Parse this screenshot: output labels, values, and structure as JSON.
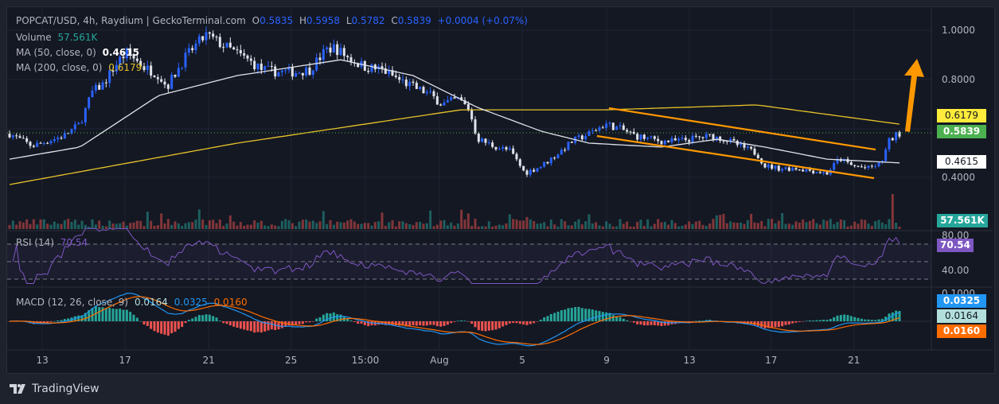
{
  "header": {
    "symbol": "POPCAT/USD, 4h, Raydium | GeckoTerminal.com",
    "o_label": "O",
    "o": "0.5835",
    "h_label": "H",
    "h": "0.5958",
    "l_label": "L",
    "l": "0.5782",
    "c_label": "C",
    "c": "0.5839",
    "change": "+0.0004 (+0.07%)"
  },
  "legend": {
    "volume_label": "Volume",
    "volume": "57.561K",
    "ma50_label": "MA (50, close, 0)",
    "ma50": "0.4615",
    "ma200_label": "MA (200, close, 0)",
    "ma200": "0.6179",
    "rsi_label": "RSI (14)",
    "rsi": "70.54",
    "macd_label": "MACD (12, 26, close, 9)",
    "macd_hist": "0.0164",
    "macd_line": "0.0325",
    "macd_signal": "0.0160"
  },
  "tags": {
    "ma200": "0.6179",
    "price": "0.5839",
    "ma50": "0.4615",
    "volume": "57.561K",
    "rsi": "70.54",
    "macd_line": "0.0325",
    "macd_hist": "0.0164",
    "macd_signal": "0.0160"
  },
  "colors": {
    "up": "#2962ff",
    "down": "#e0e3eb",
    "ma50": "#e0e3eb",
    "ma200": "#e6c229",
    "rsi": "#7e57c2",
    "macd": "#2196f3",
    "signal": "#ff6d00",
    "channel": "#ff9800",
    "price_tag": "#4caf50",
    "volume_tag": "#26a69a"
  },
  "branding": "TradingView",
  "chart_data": {
    "type": "candlestick",
    "title": "POPCAT/USD, 4h, Raydium",
    "price_axis": {
      "ticks": [
        "1.0000",
        "0.8000",
        "0.4000"
      ],
      "tick_values": [
        1.0,
        0.8,
        0.4
      ],
      "ylim": [
        0.235,
        1.09
      ]
    },
    "rsi_axis": {
      "ticks": [
        "80.00",
        "40.00"
      ],
      "tick_values": [
        80,
        40
      ],
      "bands": [
        70,
        50,
        30
      ]
    },
    "macd_axis": {
      "ticks": [
        "0.1000"
      ]
    },
    "time_axis": {
      "labels": [
        "13",
        "17",
        "21",
        "25",
        "15:00",
        "Aug",
        "5",
        "9",
        "13",
        "17",
        "21"
      ],
      "day_offsets": [
        1.58,
        5.58,
        9.62,
        13.6,
        17.19,
        20.77,
        24.77,
        28.85,
        32.85,
        36.8,
        40.8
      ]
    },
    "close_trace_days_price": [
      [
        0,
        0.58
      ],
      [
        1.1,
        0.53
      ],
      [
        1.8,
        0.55
      ],
      [
        2.6,
        0.57
      ],
      [
        3.4,
        0.62
      ],
      [
        4,
        0.75
      ],
      [
        4.5,
        0.78
      ],
      [
        5.3,
        0.88
      ],
      [
        5.7,
        0.91
      ],
      [
        6.5,
        0.85
      ],
      [
        7.2,
        0.82
      ],
      [
        7.6,
        0.77
      ],
      [
        8.4,
        0.88
      ],
      [
        8.9,
        0.93
      ],
      [
        9.5,
        0.98
      ],
      [
        10.7,
        0.92
      ],
      [
        11.5,
        0.88
      ],
      [
        12.2,
        0.84
      ],
      [
        13,
        0.83
      ],
      [
        13.8,
        0.83
      ],
      [
        14.5,
        0.84
      ],
      [
        15.3,
        0.92
      ],
      [
        15.7,
        0.93
      ],
      [
        16.5,
        0.88
      ],
      [
        17.2,
        0.85
      ],
      [
        18,
        0.84
      ],
      [
        18.8,
        0.8
      ],
      [
        19.5,
        0.77
      ],
      [
        20.3,
        0.74
      ],
      [
        20.9,
        0.7
      ],
      [
        21.7,
        0.72
      ],
      [
        22.2,
        0.68
      ],
      [
        22.6,
        0.56
      ],
      [
        23.4,
        0.53
      ],
      [
        24.2,
        0.51
      ],
      [
        24.9,
        0.42
      ],
      [
        25.7,
        0.45
      ],
      [
        26.5,
        0.5
      ],
      [
        27.2,
        0.55
      ],
      [
        28,
        0.58
      ],
      [
        28.8,
        0.62
      ],
      [
        29.5,
        0.6
      ],
      [
        30.3,
        0.57
      ],
      [
        31.5,
        0.55
      ],
      [
        32.2,
        0.55
      ],
      [
        33,
        0.56
      ],
      [
        33.8,
        0.57
      ],
      [
        34.5,
        0.56
      ],
      [
        35.3,
        0.53
      ],
      [
        36.1,
        0.5
      ],
      [
        36.5,
        0.45
      ],
      [
        37.2,
        0.44
      ],
      [
        38,
        0.44
      ],
      [
        38.8,
        0.43
      ],
      [
        39.5,
        0.42
      ],
      [
        40.1,
        0.48
      ],
      [
        40.7,
        0.45
      ],
      [
        41.5,
        0.44
      ],
      [
        42.1,
        0.46
      ],
      [
        42.5,
        0.55
      ],
      [
        42.9,
        0.58
      ],
      [
        43.1,
        0.5839
      ]
    ],
    "ma50_trace": [
      [
        0,
        0.477
      ],
      [
        3.4,
        0.526
      ],
      [
        7.2,
        0.735
      ],
      [
        11,
        0.816
      ],
      [
        16,
        0.88
      ],
      [
        19.5,
        0.816
      ],
      [
        22.6,
        0.687
      ],
      [
        25.7,
        0.59
      ],
      [
        28,
        0.542
      ],
      [
        31.5,
        0.526
      ],
      [
        34.2,
        0.558
      ],
      [
        36.5,
        0.526
      ],
      [
        39.5,
        0.477
      ],
      [
        43.1,
        0.4615
      ]
    ],
    "ma200_trace": [
      [
        0,
        0.374
      ],
      [
        11,
        0.542
      ],
      [
        21.8,
        0.677
      ],
      [
        28.8,
        0.677
      ],
      [
        36.1,
        0.697
      ],
      [
        43.1,
        0.6179
      ]
    ],
    "channel_upper": [
      [
        28.96,
        0.684
      ],
      [
        41.85,
        0.516
      ]
    ],
    "channel_lower": [
      [
        28.38,
        0.571
      ],
      [
        41.77,
        0.4
      ]
    ],
    "last_volume": "57.561K",
    "last_rsi": 70.54,
    "last_macd": {
      "macd": 0.0325,
      "signal": 0.016,
      "hist": 0.0164
    }
  }
}
